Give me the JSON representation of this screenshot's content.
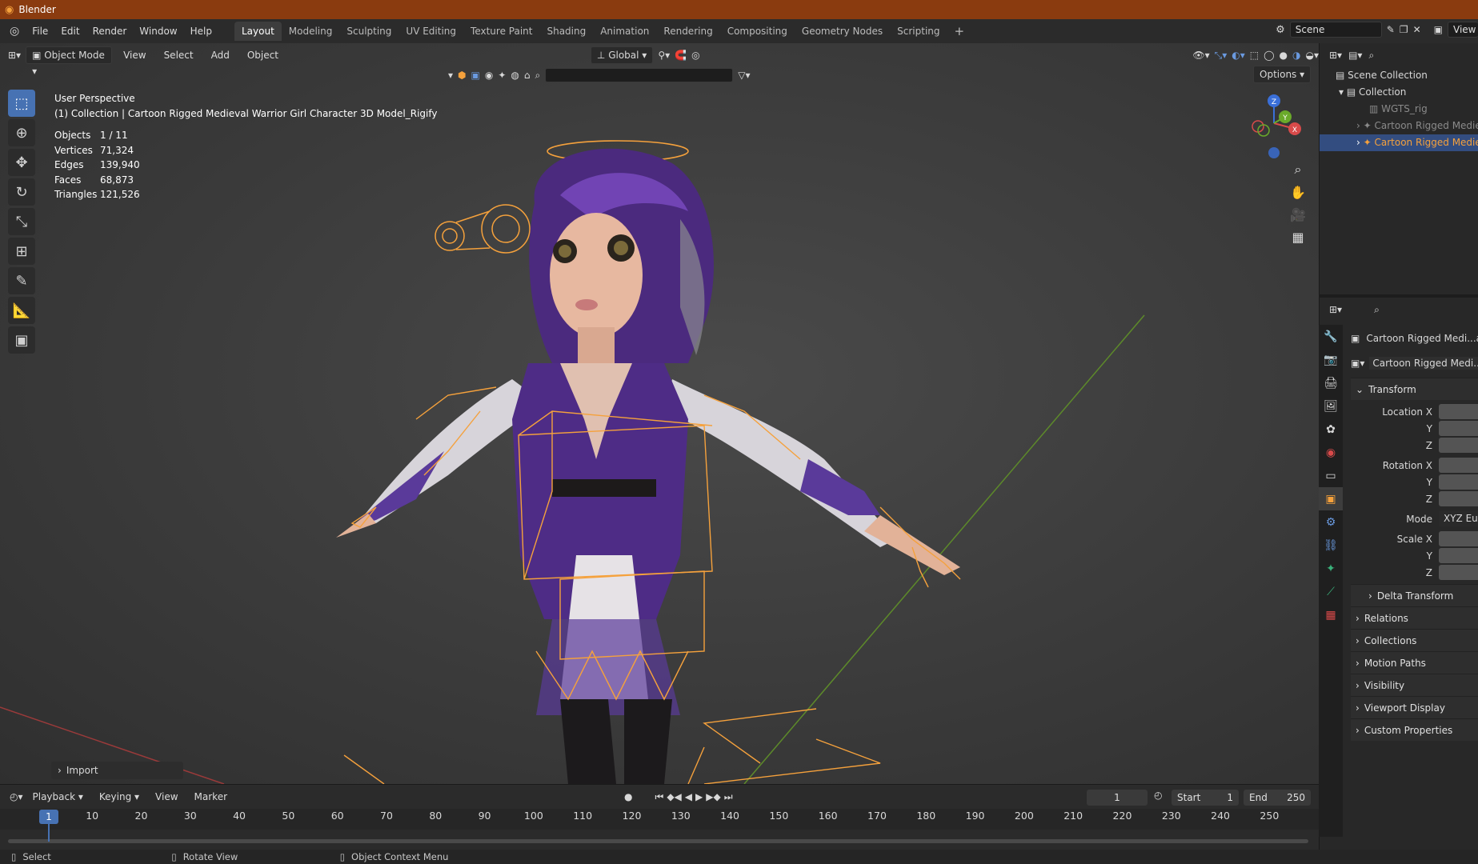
{
  "titlebar": {
    "app_icon": "blender-logo-icon",
    "title": "Blender"
  },
  "menu": {
    "items": [
      "File",
      "Edit",
      "Render",
      "Window",
      "Help"
    ]
  },
  "workspaces": {
    "tabs": [
      "Layout",
      "Modeling",
      "Sculpting",
      "UV Editing",
      "Texture Paint",
      "Shading",
      "Animation",
      "Rendering",
      "Compositing",
      "Geometry Nodes",
      "Scripting"
    ],
    "active": "Layout",
    "add_label": "+"
  },
  "scene": {
    "name": "Scene",
    "view_layer_label": "View"
  },
  "viewport_header": {
    "mode": "Object Mode",
    "menus": [
      "View",
      "Select",
      "Add",
      "Object"
    ],
    "transform_orientation": "Global",
    "options_label": "Options"
  },
  "overlay_text": {
    "perspective": "User Perspective",
    "collection_line": "(1) Collection | Cartoon Rigged Medieval Warrior Girl Character 3D Model_Rigify"
  },
  "stats": [
    {
      "label": "Objects",
      "value": "1 / 11"
    },
    {
      "label": "Vertices",
      "value": "71,324"
    },
    {
      "label": "Edges",
      "value": "139,940"
    },
    {
      "label": "Faces",
      "value": "68,873"
    },
    {
      "label": "Triangles",
      "value": "121,526"
    }
  ],
  "gizmo": {
    "z": "Z",
    "y": "Y",
    "x": "X"
  },
  "import_panel": {
    "label": "Import"
  },
  "outliner": {
    "rows": [
      {
        "label": "Scene Collection",
        "selected": false,
        "dim": false
      },
      {
        "label": "Collection",
        "selected": false,
        "dim": false
      },
      {
        "label": "WGTS_rig",
        "selected": false,
        "dim": true
      },
      {
        "label": "Cartoon Rigged Medie",
        "selected": false,
        "dim": true
      },
      {
        "label": "Cartoon Rigged Medie",
        "selected": true,
        "dim": false
      }
    ]
  },
  "properties": {
    "object_name": "Cartoon Rigged Medi...act",
    "data_name": "Cartoon Rigged Medi...",
    "transform_label": "Transform",
    "location_x": "Location X",
    "rotation_x": "Rotation X",
    "y": "Y",
    "z": "Z",
    "mode_label": "Mode",
    "mode_value": "XYZ Eu",
    "scale_x": "Scale X",
    "delta_transform": "Delta Transform",
    "sections": [
      "Relations",
      "Collections",
      "Motion Paths",
      "Visibility",
      "Viewport Display",
      "Custom Properties"
    ]
  },
  "timeline": {
    "menus": [
      "Playback",
      "Keying",
      "View",
      "Marker"
    ],
    "current_frame": "1",
    "start_label": "Start",
    "start_value": "1",
    "end_label": "End",
    "end_value": "250",
    "ruler": [
      "10",
      "20",
      "30",
      "40",
      "50",
      "60",
      "70",
      "80",
      "90",
      "100",
      "110",
      "120",
      "130",
      "140",
      "150",
      "160",
      "170",
      "180",
      "190",
      "200",
      "210",
      "220",
      "230",
      "240",
      "250"
    ]
  },
  "statusbar": {
    "items": [
      "Select",
      "Rotate View",
      "Object Context Menu"
    ]
  },
  "colors": {
    "accent": "#4772b3",
    "selection": "#f5a13c",
    "titlebar": "#8a3b0f"
  }
}
